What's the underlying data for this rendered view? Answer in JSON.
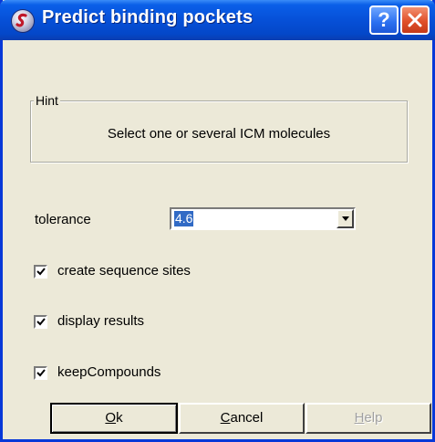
{
  "window": {
    "title": "Predict binding pockets",
    "title_help_glyph": "?"
  },
  "hint": {
    "legend": "Hint",
    "text": "Select one or several ICM molecules"
  },
  "tolerance": {
    "label": "tolerance",
    "value": "4.6"
  },
  "options": [
    {
      "label": "create sequence sites",
      "checked": true
    },
    {
      "label": "display results",
      "checked": true
    },
    {
      "label": "keepCompounds",
      "checked": true
    }
  ],
  "buttons": {
    "ok_mnemonic": "O",
    "ok_rest": "k",
    "cancel_mnemonic": "C",
    "cancel_rest": "ancel",
    "help_mnemonic": "H",
    "help_rest": "elp",
    "help_enabled": false
  },
  "colors": {
    "titlebar": "#0650d8",
    "selection": "#316ac5",
    "dialog_bg": "#ece9d8",
    "close": "#e0502a"
  }
}
